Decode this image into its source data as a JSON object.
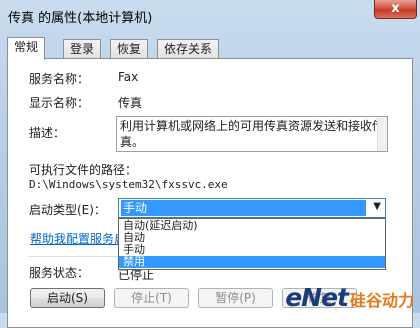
{
  "window": {
    "title": "传真 的属性(本地计算机)",
    "close_label": "x"
  },
  "tabs": [
    {
      "label": "常规",
      "active": true
    },
    {
      "label": "登录",
      "active": false
    },
    {
      "label": "恢复",
      "active": false
    },
    {
      "label": "依存关系",
      "active": false
    }
  ],
  "general": {
    "service_name_label": "服务名称：",
    "service_name": "Fax",
    "display_name_label": "显示名称：",
    "display_name": "传真",
    "description_label": "描述：",
    "description": "利用计算机或网络上的可用传真资源发送和接收传真。",
    "path_label": "可执行文件的路径：",
    "path": "D:\\Windows\\system32\\fxssvc.exe",
    "startup_type_label": "启动类型(E)：",
    "startup_type_value": "手动",
    "startup_options": [
      "自动(延迟启动)",
      "自动",
      "手动",
      "禁用"
    ],
    "startup_highlighted_index": 3,
    "help_link": "帮助我配置服务启",
    "status_label": "服务状态：",
    "status_value": "已停止"
  },
  "buttons": {
    "start": "启动(S)",
    "stop": "停止(T)",
    "pause": "暂停(P)",
    "resume": "恢复"
  },
  "watermark": {
    "brand": "eNet",
    "cn": "硅谷动力"
  }
}
